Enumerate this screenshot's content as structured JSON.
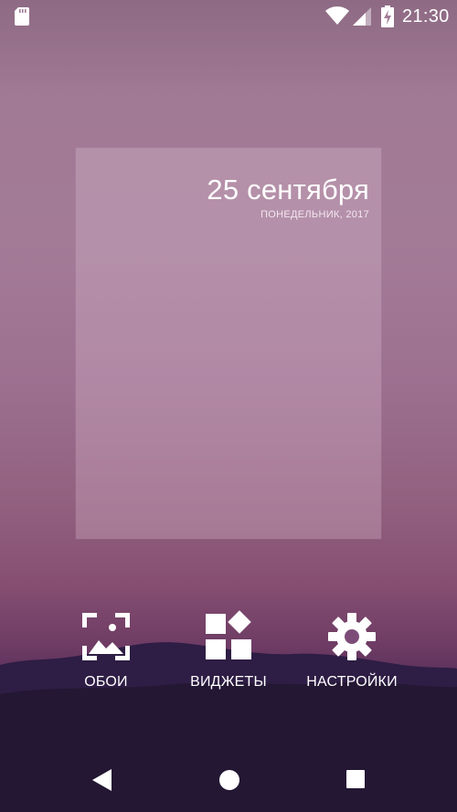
{
  "status_bar": {
    "time": "21:30",
    "icons": [
      "sd-card-icon",
      "wifi-icon",
      "signal-icon",
      "battery-charging-icon"
    ]
  },
  "preview": {
    "date": "25 сентября",
    "weekday_year": "ПОНЕДЕЛЬНИК, 2017"
  },
  "actions": [
    {
      "label": "ОБОИ",
      "icon": "wallpaper-icon"
    },
    {
      "label": "ВИДЖЕТЫ",
      "icon": "widgets-icon"
    },
    {
      "label": "НАСТРОЙКИ",
      "icon": "settings-gear-icon"
    }
  ],
  "navigation": {
    "buttons": [
      "back-icon",
      "home-icon",
      "recents-icon"
    ]
  },
  "colors": {
    "text": "#ffffff",
    "wallpaper_top": "#a37b97",
    "wallpaper_bottom": "#221733"
  }
}
